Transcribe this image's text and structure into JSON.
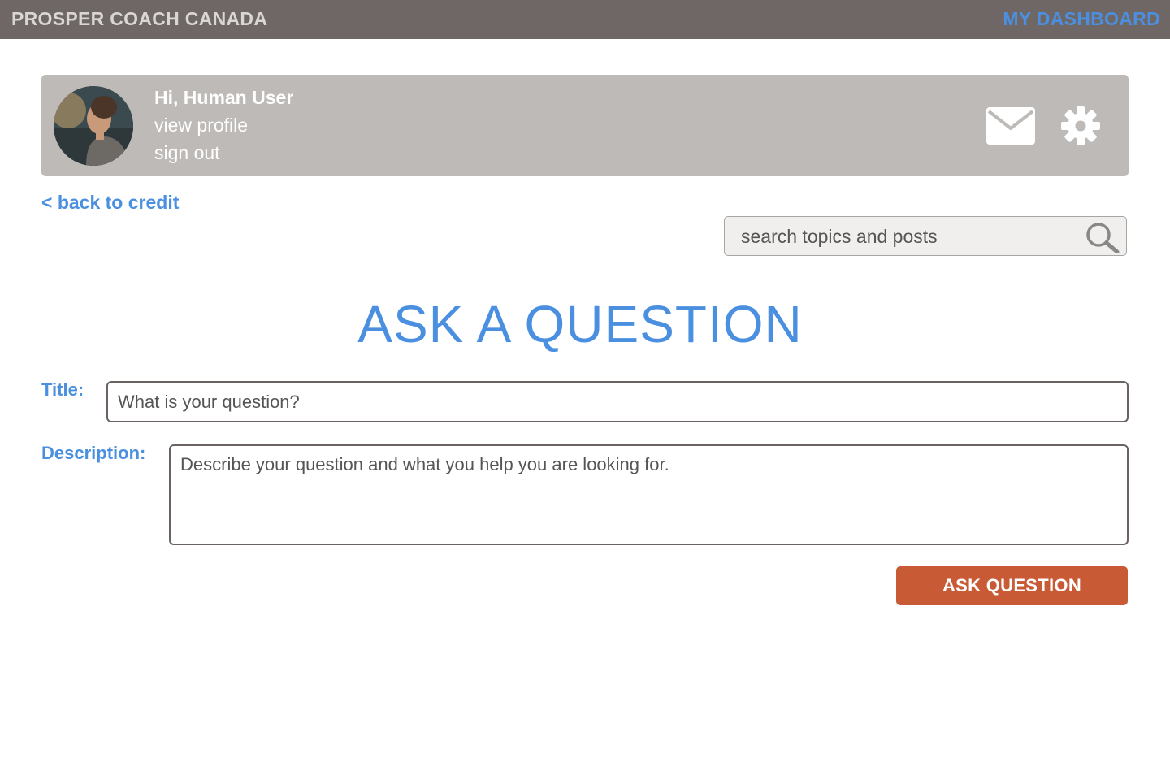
{
  "app": {
    "brand": "PROSPER COACH CANADA",
    "dashboard_link": "MY DASHBOARD"
  },
  "profile": {
    "greeting": "Hi, Human User",
    "view_profile": "view profile",
    "sign_out": "sign out"
  },
  "nav": {
    "back_link": "< back to credit"
  },
  "search": {
    "placeholder": "search topics and posts"
  },
  "form": {
    "heading": "ASK A QUESTION",
    "title_label": "Title:",
    "title_placeholder": "What is your question?",
    "description_label": "Description:",
    "description_placeholder": "Describe your question and what you help you are looking for.",
    "submit_label": "ASK QUESTION"
  },
  "colors": {
    "topbar": "#6f6766",
    "accent": "#4a8fe0",
    "profile_card": "#bdbab7",
    "button": "#c85a35"
  },
  "icons": [
    "mail-icon",
    "gear-icon",
    "search-icon"
  ]
}
